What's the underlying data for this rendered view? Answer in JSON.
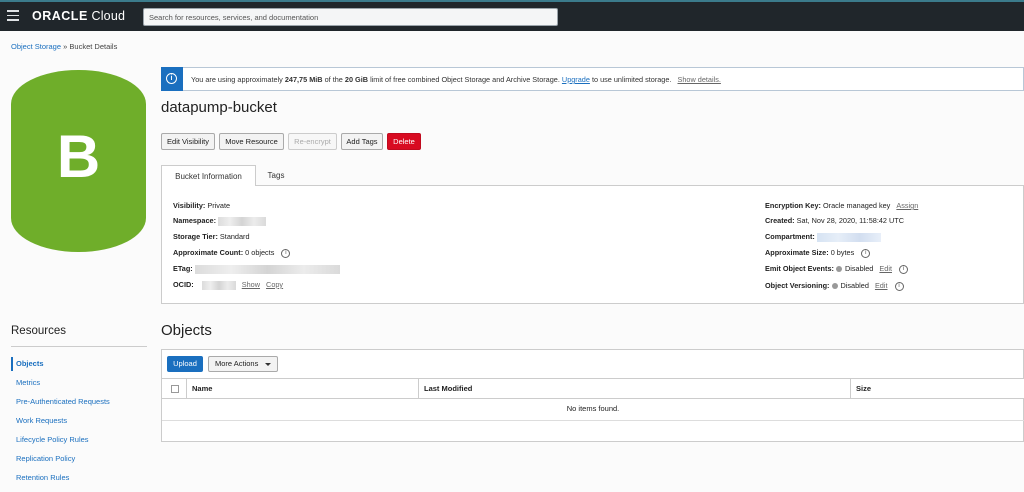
{
  "header": {
    "logo_brand": "ORACLE",
    "logo_product": "Cloud",
    "search_placeholder": "Search for resources, services, and documentation"
  },
  "breadcrumb": {
    "root": "Object Storage",
    "separator": "»",
    "current": "Bucket Details"
  },
  "avatar": {
    "letter": "B",
    "color": "#6fae2a"
  },
  "banner": {
    "text_before": "You are using approximately",
    "usage": "247,75 MiB",
    "text_mid": "of the",
    "limit": "20 GiB",
    "text_after": "limit of free combined Object Storage and Archive Storage.",
    "upgrade_link": "Upgrade",
    "text_end": "to use unlimited storage.",
    "show_details": "Show details."
  },
  "bucket": {
    "name": "datapump-bucket"
  },
  "actions": {
    "edit_visibility": "Edit Visibility",
    "move_resource": "Move Resource",
    "re_encrypt": "Re-encrypt",
    "add_tags": "Add Tags",
    "delete": "Delete"
  },
  "tabs": [
    {
      "label": "Bucket Information",
      "active": true
    },
    {
      "label": "Tags",
      "active": false
    }
  ],
  "info_left": {
    "visibility_label": "Visibility:",
    "visibility_value": "Private",
    "namespace_label": "Namespace:",
    "storage_tier_label": "Storage Tier:",
    "storage_tier_value": "Standard",
    "approx_count_label": "Approximate Count:",
    "approx_count_value": "0 objects",
    "etag_label": "ETag:",
    "ocid_label": "OCID:",
    "ocid_show": "Show",
    "ocid_copy": "Copy"
  },
  "info_right": {
    "encryption_label": "Encryption Key:",
    "encryption_value": "Oracle managed key",
    "encryption_assign": "Assign",
    "created_label": "Created:",
    "created_value": "Sat, Nov 28, 2020, 11:58:42 UTC",
    "compartment_label": "Compartment:",
    "approx_size_label": "Approximate Size:",
    "approx_size_value": "0 bytes",
    "emit_events_label": "Emit Object Events:",
    "emit_events_value": "Disabled",
    "emit_events_edit": "Edit",
    "versioning_label": "Object Versioning:",
    "versioning_value": "Disabled",
    "versioning_edit": "Edit"
  },
  "resources": {
    "title": "Resources",
    "items": [
      "Objects",
      "Metrics",
      "Pre-Authenticated Requests",
      "Work Requests",
      "Lifecycle Policy Rules",
      "Replication Policy",
      "Retention Rules"
    ]
  },
  "objects": {
    "title": "Objects",
    "upload": "Upload",
    "more_actions": "More Actions",
    "columns": [
      "Name",
      "Last Modified",
      "Size"
    ],
    "empty_message": "No items found."
  },
  "colors": {
    "accent": "#1a6fbf",
    "danger": "#d80b21",
    "topbar": "#20262b"
  }
}
